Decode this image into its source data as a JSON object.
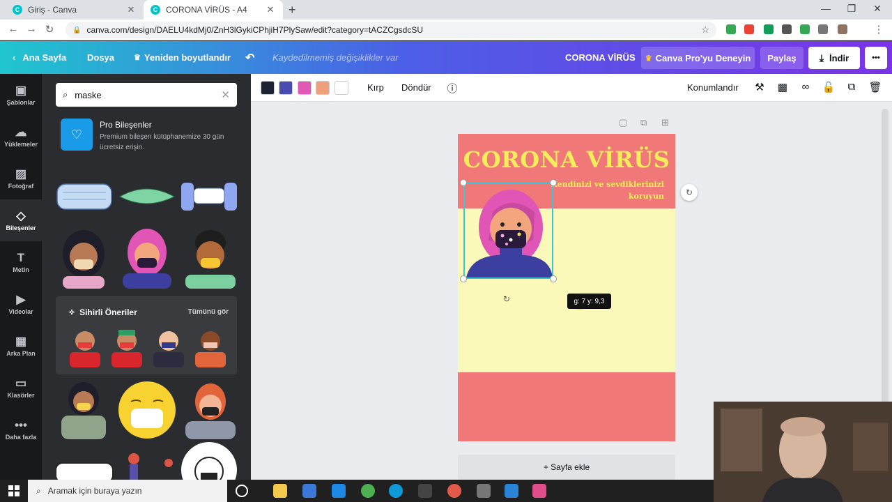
{
  "browser": {
    "tabs": [
      {
        "title": "Giriş - Canva",
        "active": false
      },
      {
        "title": "CORONA VİRÜS - A4",
        "active": true
      }
    ],
    "url": "canva.com/design/DAELU4kdMj0/ZnH3lGykiCPhjiH7PlySaw/edit?category=tACZCgsdcSU"
  },
  "header": {
    "home": "Ana Sayfa",
    "file": "Dosya",
    "resize": "Yeniden boyutlandır",
    "unsaved": "Kaydedilmemiş değişiklikler var",
    "doc_title": "CORONA VİRÜS",
    "try_pro": "Canva Pro'yu Deneyin",
    "share": "Paylaş",
    "download": "İndir",
    "more": "•••"
  },
  "rail": {
    "items": [
      {
        "label": "Şablonlar",
        "icon": "template-icon"
      },
      {
        "label": "Yüklemeler",
        "icon": "upload-icon"
      },
      {
        "label": "Fotoğraf",
        "icon": "photo-icon"
      },
      {
        "label": "Bileşenler",
        "icon": "elements-icon",
        "selected": true
      },
      {
        "label": "Metin",
        "icon": "text-icon"
      },
      {
        "label": "Videolar",
        "icon": "video-icon"
      },
      {
        "label": "Arka Plan",
        "icon": "background-icon"
      },
      {
        "label": "Klasörler",
        "icon": "folder-icon"
      },
      {
        "label": "Daha fazla",
        "icon": "more-icon"
      }
    ]
  },
  "panel": {
    "search_value": "maske",
    "pro_title": "Pro Bileşenler",
    "pro_desc": "Premium bileşen kütüphanemize 30 gün ücretsiz erişin.",
    "magic_title": "Sihirli Öneriler",
    "magic_link": "Tümünü gör"
  },
  "toolbar": {
    "colors": [
      "#1e2235",
      "#4a4db0",
      "#e05ab5",
      "#eea07a",
      "#ffffff"
    ],
    "crop": "Kırp",
    "flip": "Döndür",
    "position": "Konumlandır"
  },
  "page": {
    "title": "CORONA VİRÜS",
    "subtitle_line1": "Kendinizi ve sevdiklerinizi",
    "subtitle_line2": "koruyun",
    "top_color": "#f07878",
    "mid_color": "#fbf9b9",
    "tooltip": "g: 7 y: 9,3",
    "add_page": "+ Sayfa ekle"
  },
  "taskbar": {
    "search_placeholder": "Aramak için buraya yazın"
  }
}
